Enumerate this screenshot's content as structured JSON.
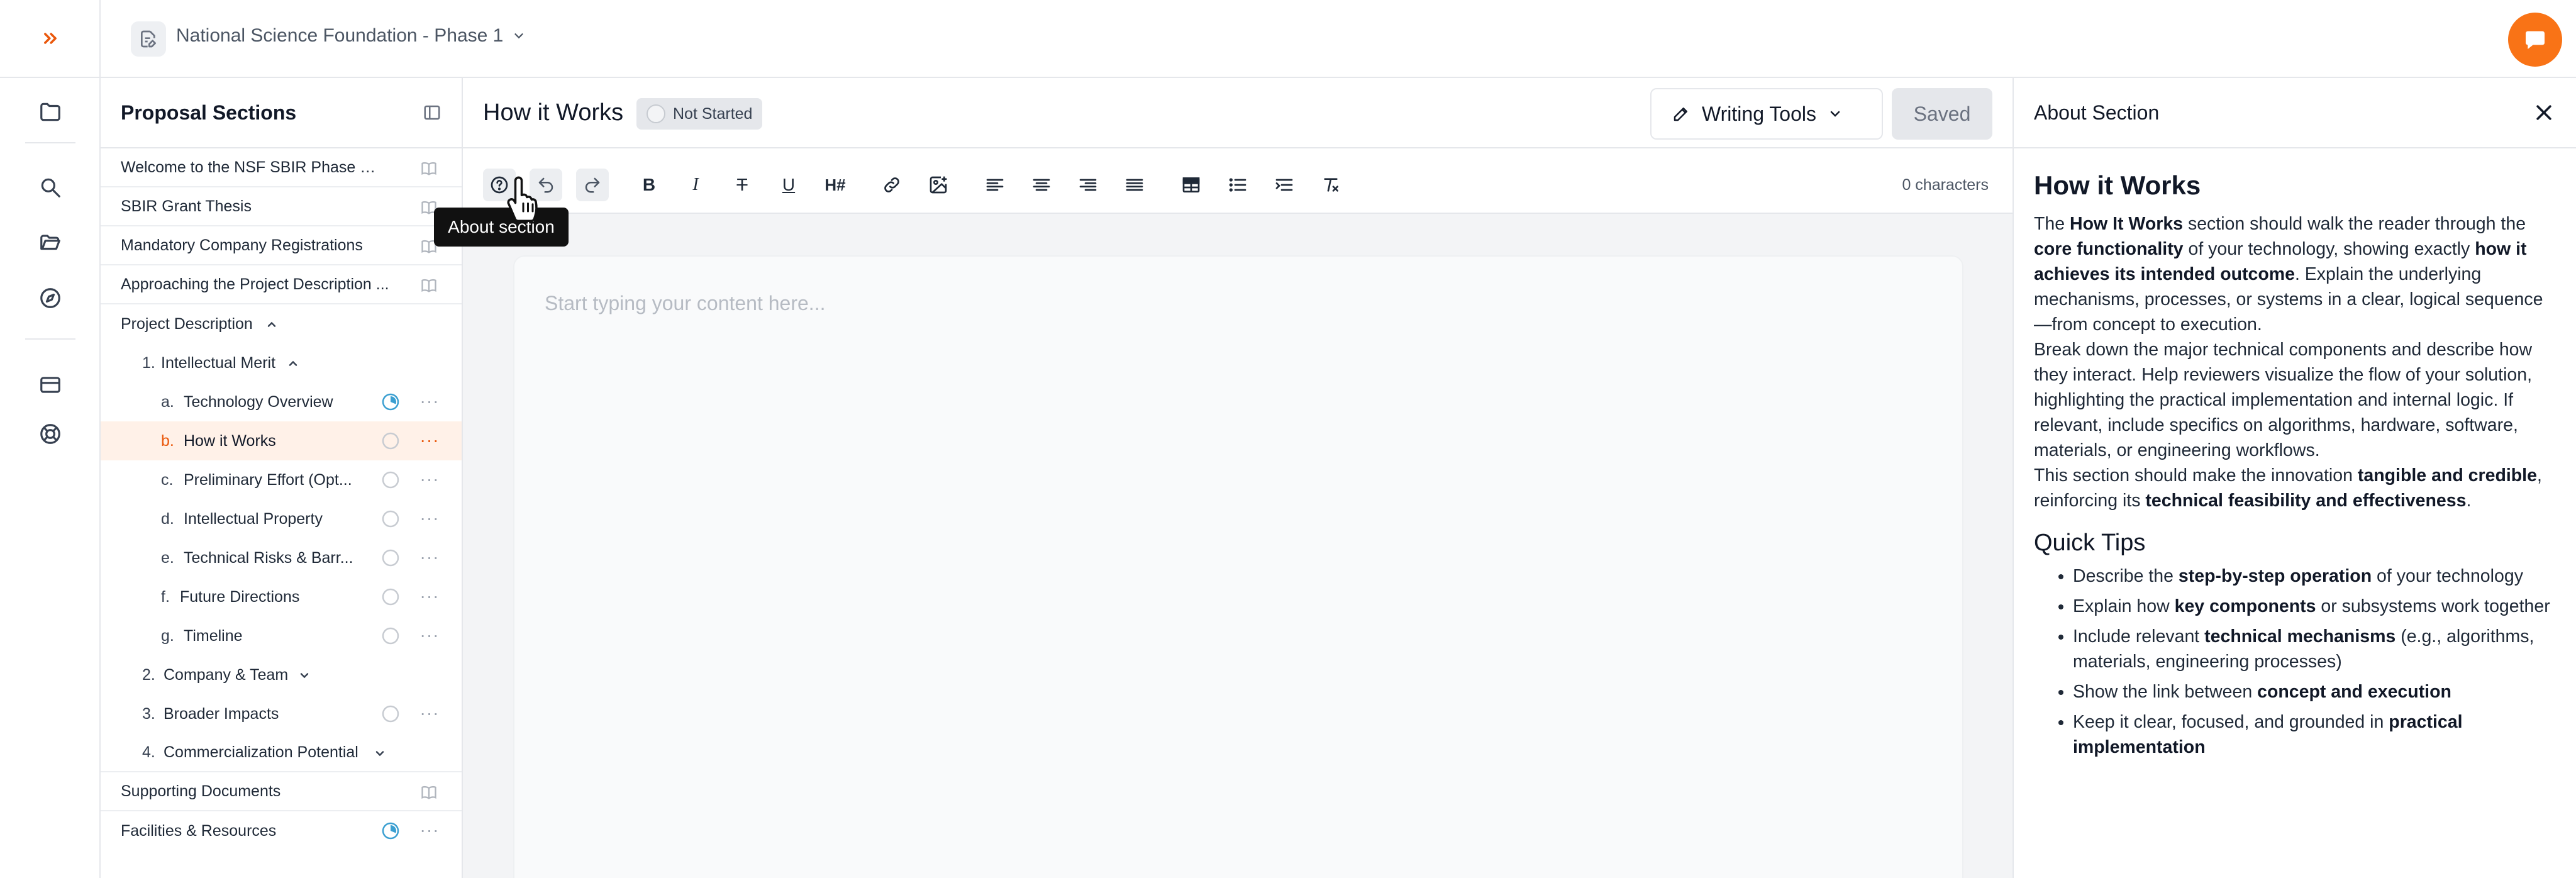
{
  "topbar": {
    "project_title": "National Science Foundation - Phase 1"
  },
  "rail": {
    "icons": [
      "expand-icon",
      "folder-icon",
      "search-icon",
      "folder-open-icon",
      "compass-icon",
      "credit-card-icon",
      "help-circle-icon"
    ]
  },
  "sections_panel": {
    "title": "Proposal Sections",
    "items": [
      {
        "label": "Welcome to the NSF SBIR Phase I Ap..."
      },
      {
        "label": "SBIR Grant Thesis"
      },
      {
        "label": "Mandatory Company Registrations"
      },
      {
        "label": "Approaching the Project Description ..."
      },
      {
        "label": "Project Description"
      },
      {
        "num": "1.",
        "label": "Intellectual Merit"
      },
      {
        "num": "a.",
        "label": "Technology Overview"
      },
      {
        "num": "b.",
        "label": "How it Works"
      },
      {
        "num": "c.",
        "label": "Preliminary Effort (Opt..."
      },
      {
        "num": "d.",
        "label": "Intellectual Property"
      },
      {
        "num": "e.",
        "label": "Technical Risks & Barr..."
      },
      {
        "num": "f.",
        "label": "Future Directions"
      },
      {
        "num": "g.",
        "label": "Timeline"
      },
      {
        "num": "2.",
        "label": "Company & Team"
      },
      {
        "num": "3.",
        "label": "Broader Impacts"
      },
      {
        "num": "4.",
        "label": "Commercialization Potential"
      },
      {
        "label": "Supporting Documents"
      },
      {
        "label": "Facilities & Resources"
      }
    ]
  },
  "editor": {
    "title": "How it Works",
    "status": "Not Started",
    "writing_tools_label": "Writing Tools",
    "saved_label": "Saved",
    "char_count": "0 characters",
    "tooltip": "About section",
    "placeholder": "Start typing your content here...",
    "heading_button": "H#"
  },
  "about": {
    "title": "About Section",
    "heading": "How it Works",
    "p1": {
      "a": "The ",
      "b": "How It Works",
      "c": " section should walk the reader through the ",
      "d": "core functionality",
      "e": " of your technology, showing exactly ",
      "f": "how it achieves its intended outcome",
      "g": ". Explain the underlying mechanisms, processes, or systems in a clear, logical sequence—from concept to execution."
    },
    "p2": "Break down the major technical components and describe how they interact. Help reviewers visualize the flow of your solution, highlighting the practical implementation and internal logic. If relevant, include specifics on algorithms, hardware, software, materials, or engineering workflows.",
    "p3": {
      "a": "This section should make the innovation ",
      "b": "tangible and credible",
      "c": ", reinforcing its ",
      "d": "technical feasibility and effectiveness",
      "e": "."
    },
    "tips_heading": "Quick Tips",
    "tips": [
      {
        "a": "Describe the ",
        "b": "step-by-step operation",
        "c": " of your technology"
      },
      {
        "a": "Explain how ",
        "b": "key components",
        "c": " or subsystems work together"
      },
      {
        "a": "Include relevant ",
        "b": "technical mechanisms",
        "c": " (e.g., algorithms, materials, engineering processes)"
      },
      {
        "a": "Show the link between ",
        "b": "concept and execution",
        "c": ""
      },
      {
        "a": "Keep it clear, focused, and grounded in ",
        "b": "practical implementation",
        "c": ""
      }
    ]
  },
  "colors": {
    "accent": "#f97316",
    "active_row_bg": "#fff1e8",
    "progress_blue": "#3b9fd1"
  }
}
